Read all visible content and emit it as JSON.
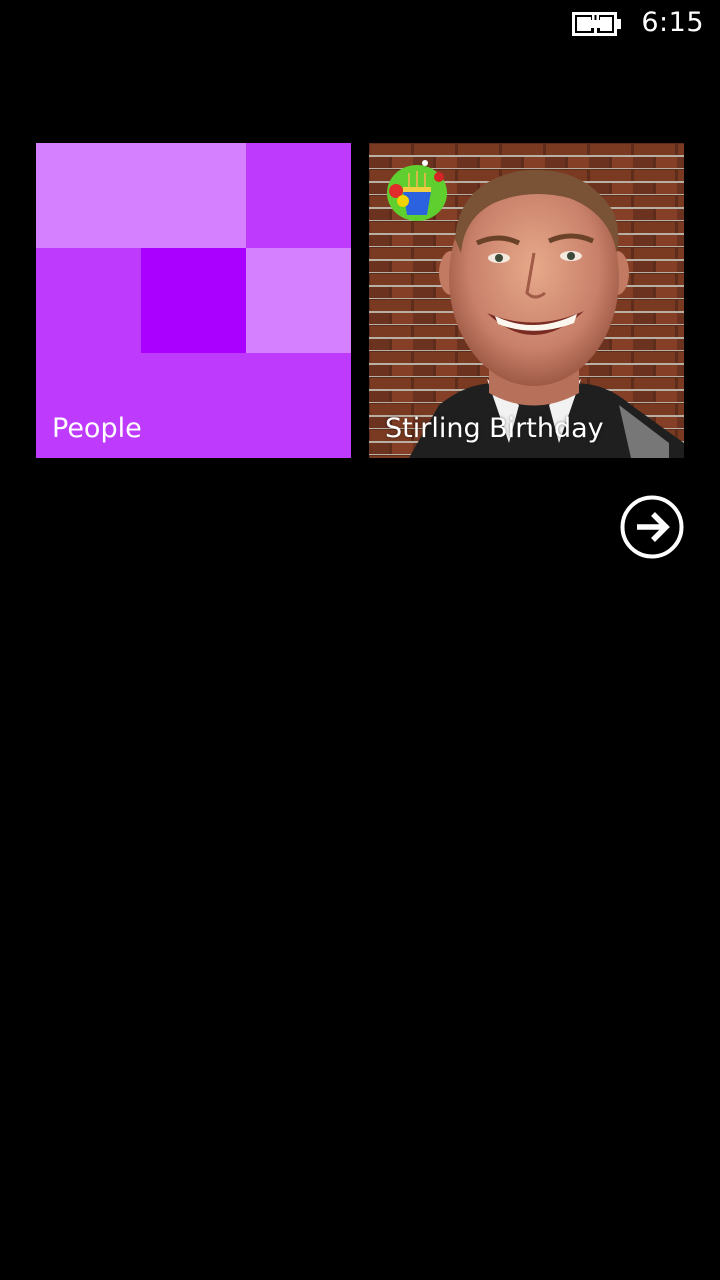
{
  "status_bar": {
    "battery_icon": "battery-charging-icon",
    "time": "6:15"
  },
  "tiles": [
    {
      "label": "People",
      "icon": "people-mosaic-icon",
      "color": "#be3bfe"
    },
    {
      "label": "Stirling Birthday",
      "icon": "birthday-cake-icon",
      "image": "contact-photo"
    }
  ],
  "navigation": {
    "next_icon": "arrow-right-circle-icon"
  },
  "colors": {
    "background": "#000000",
    "accent": "#be3bfe",
    "accent_light": "#d580ff",
    "accent_dark": "#aa00ff"
  }
}
